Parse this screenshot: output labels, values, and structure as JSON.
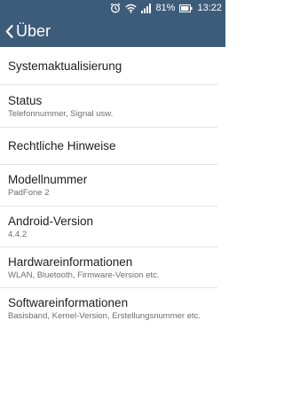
{
  "status_bar": {
    "battery_text": "81%",
    "time": "13:22",
    "icons": [
      "alarm-icon",
      "wifi-icon",
      "signal-icon",
      "battery-icon"
    ]
  },
  "app_bar": {
    "title": "Über",
    "back_icon": "chevron-left-icon",
    "background": "#3d5c7a"
  },
  "settings": {
    "items": [
      {
        "title": "Systemaktualisierung",
        "subtitle": ""
      },
      {
        "title": "Status",
        "subtitle": "Telefonnummer, Signal usw."
      },
      {
        "title": "Rechtliche Hinweise",
        "subtitle": ""
      },
      {
        "title": "Modellnummer",
        "subtitle": "PadFone 2"
      },
      {
        "title": "Android-Version",
        "subtitle": "4.4.2"
      },
      {
        "title": "Hardwareinformationen",
        "subtitle": "WLAN, Bluetooth, Firmware-Version etc."
      },
      {
        "title": "Softwareinformationen",
        "subtitle": "Basisband, Kernel-Version, Erstellungsnummer etc."
      }
    ]
  }
}
